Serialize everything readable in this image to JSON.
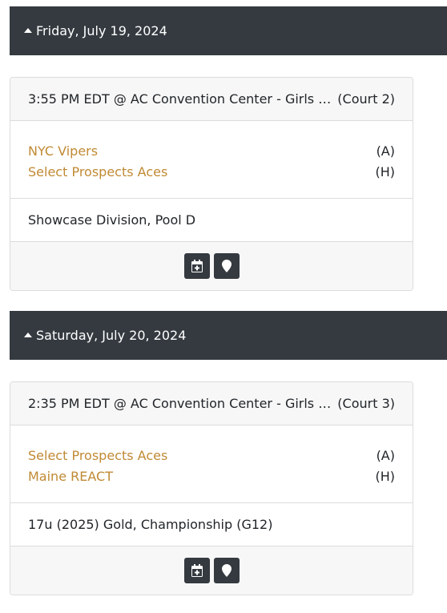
{
  "days": [
    {
      "date": "Friday, July 19, 2024",
      "game": {
        "time_location": "3:55 PM EDT @ AC Convention Center - Girls Ch...",
        "court": "(Court 2)",
        "teams": [
          {
            "name": "NYC Vipers",
            "side": "(A)"
          },
          {
            "name": "Select Prospects Aces",
            "side": "(H)"
          }
        ],
        "division": "Showcase Division, Pool D",
        "actions": [
          {
            "icon": "calendar-add-icon"
          },
          {
            "icon": "map-marker-icon"
          }
        ]
      }
    },
    {
      "date": "Saturday, July 20, 2024",
      "game": {
        "time_location": "2:35 PM EDT @ AC Convention Center - Girls Ch...",
        "court": "(Court 3)",
        "teams": [
          {
            "name": "Select Prospects Aces",
            "side": "(A)"
          },
          {
            "name": "Maine REACT",
            "side": "(H)"
          }
        ],
        "division": "17u (2025) Gold, Championship (G12)",
        "actions": [
          {
            "icon": "calendar-add-icon"
          },
          {
            "icon": "map-marker-icon"
          }
        ]
      }
    }
  ],
  "colors": {
    "header_bg": "#343a40",
    "team_link": "#c08a34",
    "card_head_bg": "#f7f7f7"
  }
}
